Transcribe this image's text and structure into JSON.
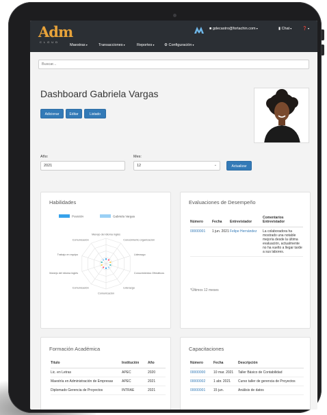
{
  "brand": {
    "logo_text": "Adm",
    "logo_sub": "CLOUD"
  },
  "nav": {
    "user_email": "gdecastro@fortachin.com",
    "chat_label": "Chat",
    "help_label": "",
    "menu": [
      "Maestras",
      "Transacciones",
      "Reportes",
      "Configuración"
    ]
  },
  "search": {
    "placeholder": "Buscar..."
  },
  "page": {
    "title": "Dashboard Gabriela Vargas"
  },
  "actions": {
    "add": "Adicionar",
    "edit": "Editar",
    "list": "Listado"
  },
  "filters": {
    "year_label": "Año:",
    "year_value": "2021",
    "month_label": "Mes:",
    "month_value": "12",
    "update": "Actualizar"
  },
  "skills": {
    "title": "Habilidades",
    "legend": [
      "Posición",
      "Gabriela Vargas"
    ],
    "axes": [
      "Manejo del idioma inglés",
      "Conocimiento organización",
      "Liderazgo",
      "Conocimientos Ofimáticos",
      "Liderazgo",
      "Comunicación",
      "Comunicación",
      "Manejo del idioma inglés",
      "Trabajo en equipo",
      "Comunicación"
    ],
    "colors": {
      "position": "#36a2eb",
      "person": "#9ad0f5",
      "accent": "#ff6384"
    }
  },
  "evaluations": {
    "title": "Evaluaciones de Desempeño",
    "headers": [
      "Número",
      "Fecha",
      "Entrevistador",
      "Comentarios Entrevistador"
    ],
    "rows": [
      {
        "number": "00000001",
        "date": "1 jun. 2021",
        "interviewer": "Felipe Hernández",
        "comment": "La colaboradora ha mostrado una notable mejoría desde la última evaluación, actualmente no ha vuelto a llegar tarde a sus labores."
      }
    ],
    "note": "*Últimos 12 meses"
  },
  "education": {
    "title": "Formación Académica",
    "headers": [
      "Título",
      "Institución",
      "Año"
    ],
    "rows": [
      {
        "title": "Lic. en Letras",
        "institution": "APEC",
        "year": "2020"
      },
      {
        "title": "Maestría en Administración de Empresas",
        "institution": "APEC",
        "year": "2021"
      },
      {
        "title": "Diplomado Gerencia de Proyectos",
        "institution": "INTRAE",
        "year": "2021"
      }
    ]
  },
  "trainings": {
    "title": "Capacitaciones",
    "headers": [
      "Número",
      "Fecha",
      "Descripción"
    ],
    "rows": [
      {
        "number": "00000000",
        "date": "10 mar. 2021",
        "description": "Taller Básico de Contabilidad"
      },
      {
        "number": "00000002",
        "date": "1 abr. 2021",
        "description": "Curso taller de gerencia de Proyectos"
      },
      {
        "number": "00000001",
        "date": "15 jun.",
        "description": "Análisis de datos"
      }
    ]
  }
}
